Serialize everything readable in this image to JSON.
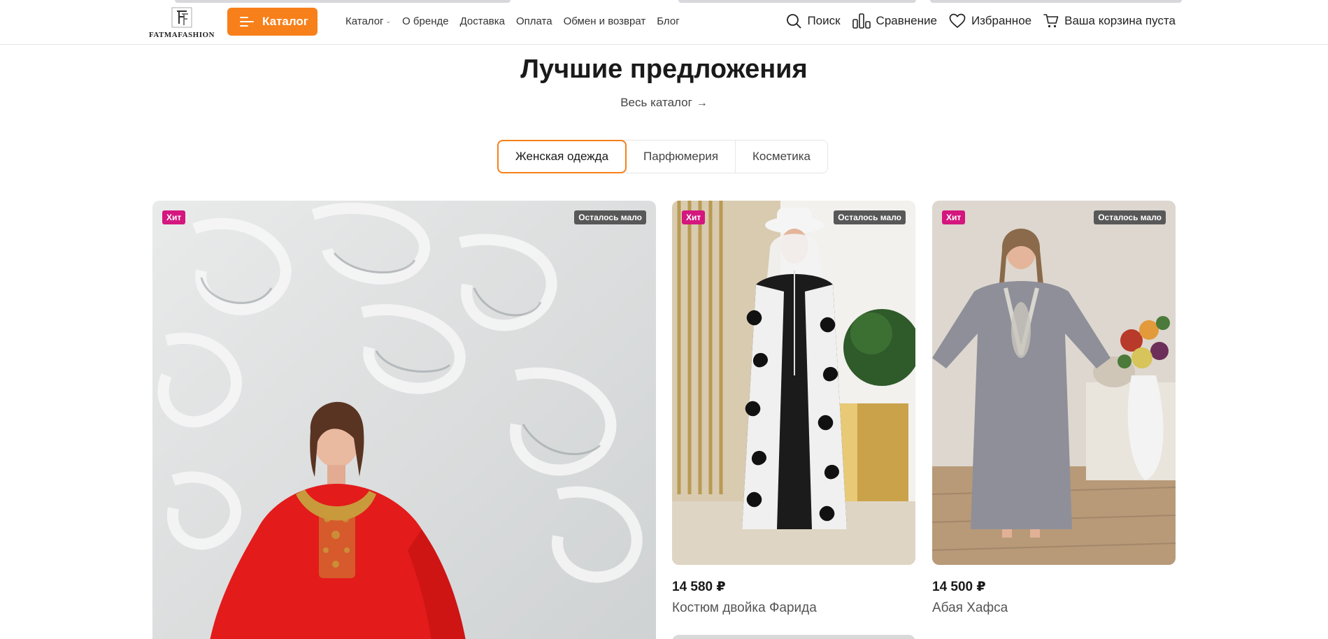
{
  "brand": {
    "logo_text": "FATMAFASHION"
  },
  "header": {
    "catalog_button": "Каталог",
    "nav": [
      {
        "label": "Каталог",
        "has_dropdown": true
      },
      {
        "label": "О бренде"
      },
      {
        "label": "Доставка"
      },
      {
        "label": "Оплата"
      },
      {
        "label": "Обмен и возврат"
      },
      {
        "label": "Блог"
      }
    ],
    "actions": {
      "search": "Поиск",
      "compare": "Сравнение",
      "favorites": "Избранное",
      "cart": "Ваша корзина пуста"
    },
    "icons": {
      "search": "search-icon",
      "compare": "compare-icon",
      "favorites": "heart-icon",
      "cart": "cart-icon",
      "menu": "menu-icon"
    }
  },
  "section": {
    "title": "Лучшие предложения",
    "all_link": "Весь каталог",
    "tabs": [
      {
        "label": "Женская одежда",
        "active": true
      },
      {
        "label": "Парфюмерия",
        "active": false
      },
      {
        "label": "Косметика",
        "active": false
      }
    ]
  },
  "products": [
    {
      "badge_hit": "Хит",
      "badge_stock": "Осталось мало",
      "price": "",
      "name": ""
    },
    {
      "badge_hit": "Хит",
      "badge_stock": "Осталось мало",
      "price": "14 580 ₽",
      "name": "Костюм двойка Фарида"
    },
    {
      "badge_hit": "Хит",
      "badge_stock": "Осталось мало",
      "price": "14 500 ₽",
      "name": "Абая Хафса"
    }
  ],
  "colors": {
    "accent": "#f7801a",
    "hit_badge": "#d4167e",
    "stock_badge": "#585858"
  }
}
